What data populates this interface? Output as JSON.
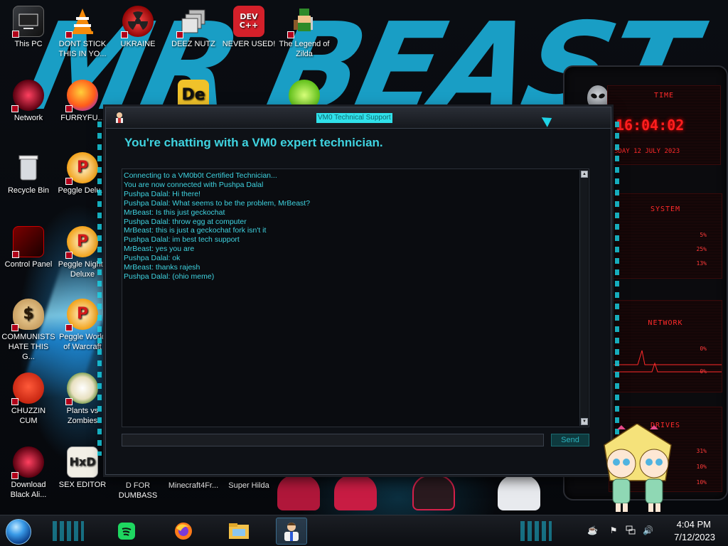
{
  "desktop": {
    "icons": [
      {
        "label": "This PC"
      },
      {
        "label": "DONT STICK THIS IN YO..."
      },
      {
        "label": "UKRAINE"
      },
      {
        "label": "DEEZ NUTZ"
      },
      {
        "label": "NEVER USED!"
      },
      {
        "label": "The Legend of Zilda"
      },
      {
        "label": "Network"
      },
      {
        "label": "FURRYFU..."
      },
      {
        "label": "Recycle Bin"
      },
      {
        "label": "Peggle Delu..."
      },
      {
        "label": "Control Panel"
      },
      {
        "label": "Peggle Nights Deluxe"
      },
      {
        "label": "COMMUNISTS HATE THIS G..."
      },
      {
        "label": "Peggle World of Warcraft"
      },
      {
        "label": "CHUZZIN CUM"
      },
      {
        "label": "Plants vs Zombies"
      },
      {
        "label": "Download Black Ali..."
      },
      {
        "label": "SEX EDITOR"
      },
      {
        "label": "D FOR DUMBASS"
      },
      {
        "label": "Minecraft4Fr..."
      },
      {
        "label": "Super Hilda"
      }
    ],
    "dev_icon_text": "DEV C++",
    "hex_icon_text": "HxD",
    "de_icon_text": "De",
    "wallpaper_text": "MR BEAST"
  },
  "gadget": {
    "time_title": "TIME",
    "clock": "16:04:02",
    "date": "SDAY 12 JULY 2023",
    "system_title": "SYSTEM",
    "system_values": [
      "5%",
      "25%",
      "13%"
    ],
    "network_title": "NETWORK",
    "network_values": [
      "0%",
      "0%"
    ],
    "drives_title": "DRIVES",
    "drive_values": [
      "31%",
      "10%",
      "10%"
    ]
  },
  "chat_window": {
    "title": "VM0 Technical Support",
    "header": "You're chatting with a VM0 expert technician.",
    "messages": [
      "Connecting to a VM0b0t Certified Technician...",
      "You are now connected with Pushpa Dalal",
      "Pushpa Dalal: Hi there!",
      "Pushpa Dalal: What seems to be the problem, MrBeast?",
      "MrBeast: Is this just geckochat",
      "Pushpa Dalal: throw egg at computer",
      "MrBeast: this is just a geckochat fork isn't it",
      "Pushpa Dalal: im best tech support",
      "MrBeast: yes you are",
      "Pushpa Dalal: ok",
      "MrBeast: thanks rajesh",
      "Pushpa Dalal: (ohio meme)"
    ],
    "input_value": "",
    "send_label": "Send"
  },
  "taskbar": {
    "apps": [
      {
        "icon": "spotify-icon"
      },
      {
        "icon": "firefox-icon"
      },
      {
        "icon": "file-explorer-icon"
      },
      {
        "icon": "tech-support-icon"
      }
    ],
    "tray_icons": [
      "java-icon",
      "flag-icon",
      "network-icon",
      "volume-icon"
    ],
    "time": "4:04 PM",
    "date": "7/12/2023"
  },
  "colors": {
    "chat_text": "#3fd3e0",
    "accent_cyan": "#18d5e8",
    "gadget_red": "#ff1e1e"
  }
}
